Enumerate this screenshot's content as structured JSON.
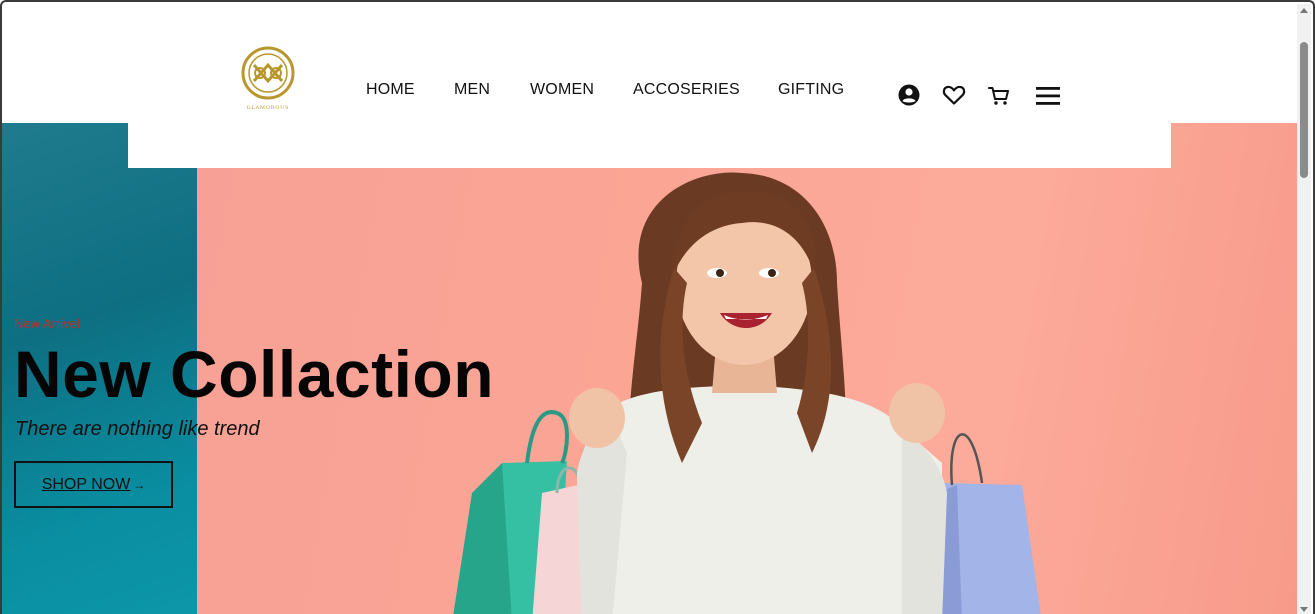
{
  "brand": {
    "logo_text": "GLAMOROUS",
    "accent": "#b8972e"
  },
  "nav": {
    "items": [
      {
        "label": "HOME"
      },
      {
        "label": "MEN"
      },
      {
        "label": "WOMEN"
      },
      {
        "label": "ACCOSERIES"
      },
      {
        "label": "GIFTING"
      }
    ]
  },
  "header_icons": [
    "account-icon",
    "heart-icon",
    "cart-icon",
    "menu-icon"
  ],
  "hero": {
    "eyebrow": "New Arrivel",
    "headline": "New Collaction",
    "tagline": "There are nothing like trend",
    "cta_label": "SHOP NOW",
    "cta_arrow": "→",
    "left_color": "#0e6f82",
    "right_color": "#fba595"
  }
}
